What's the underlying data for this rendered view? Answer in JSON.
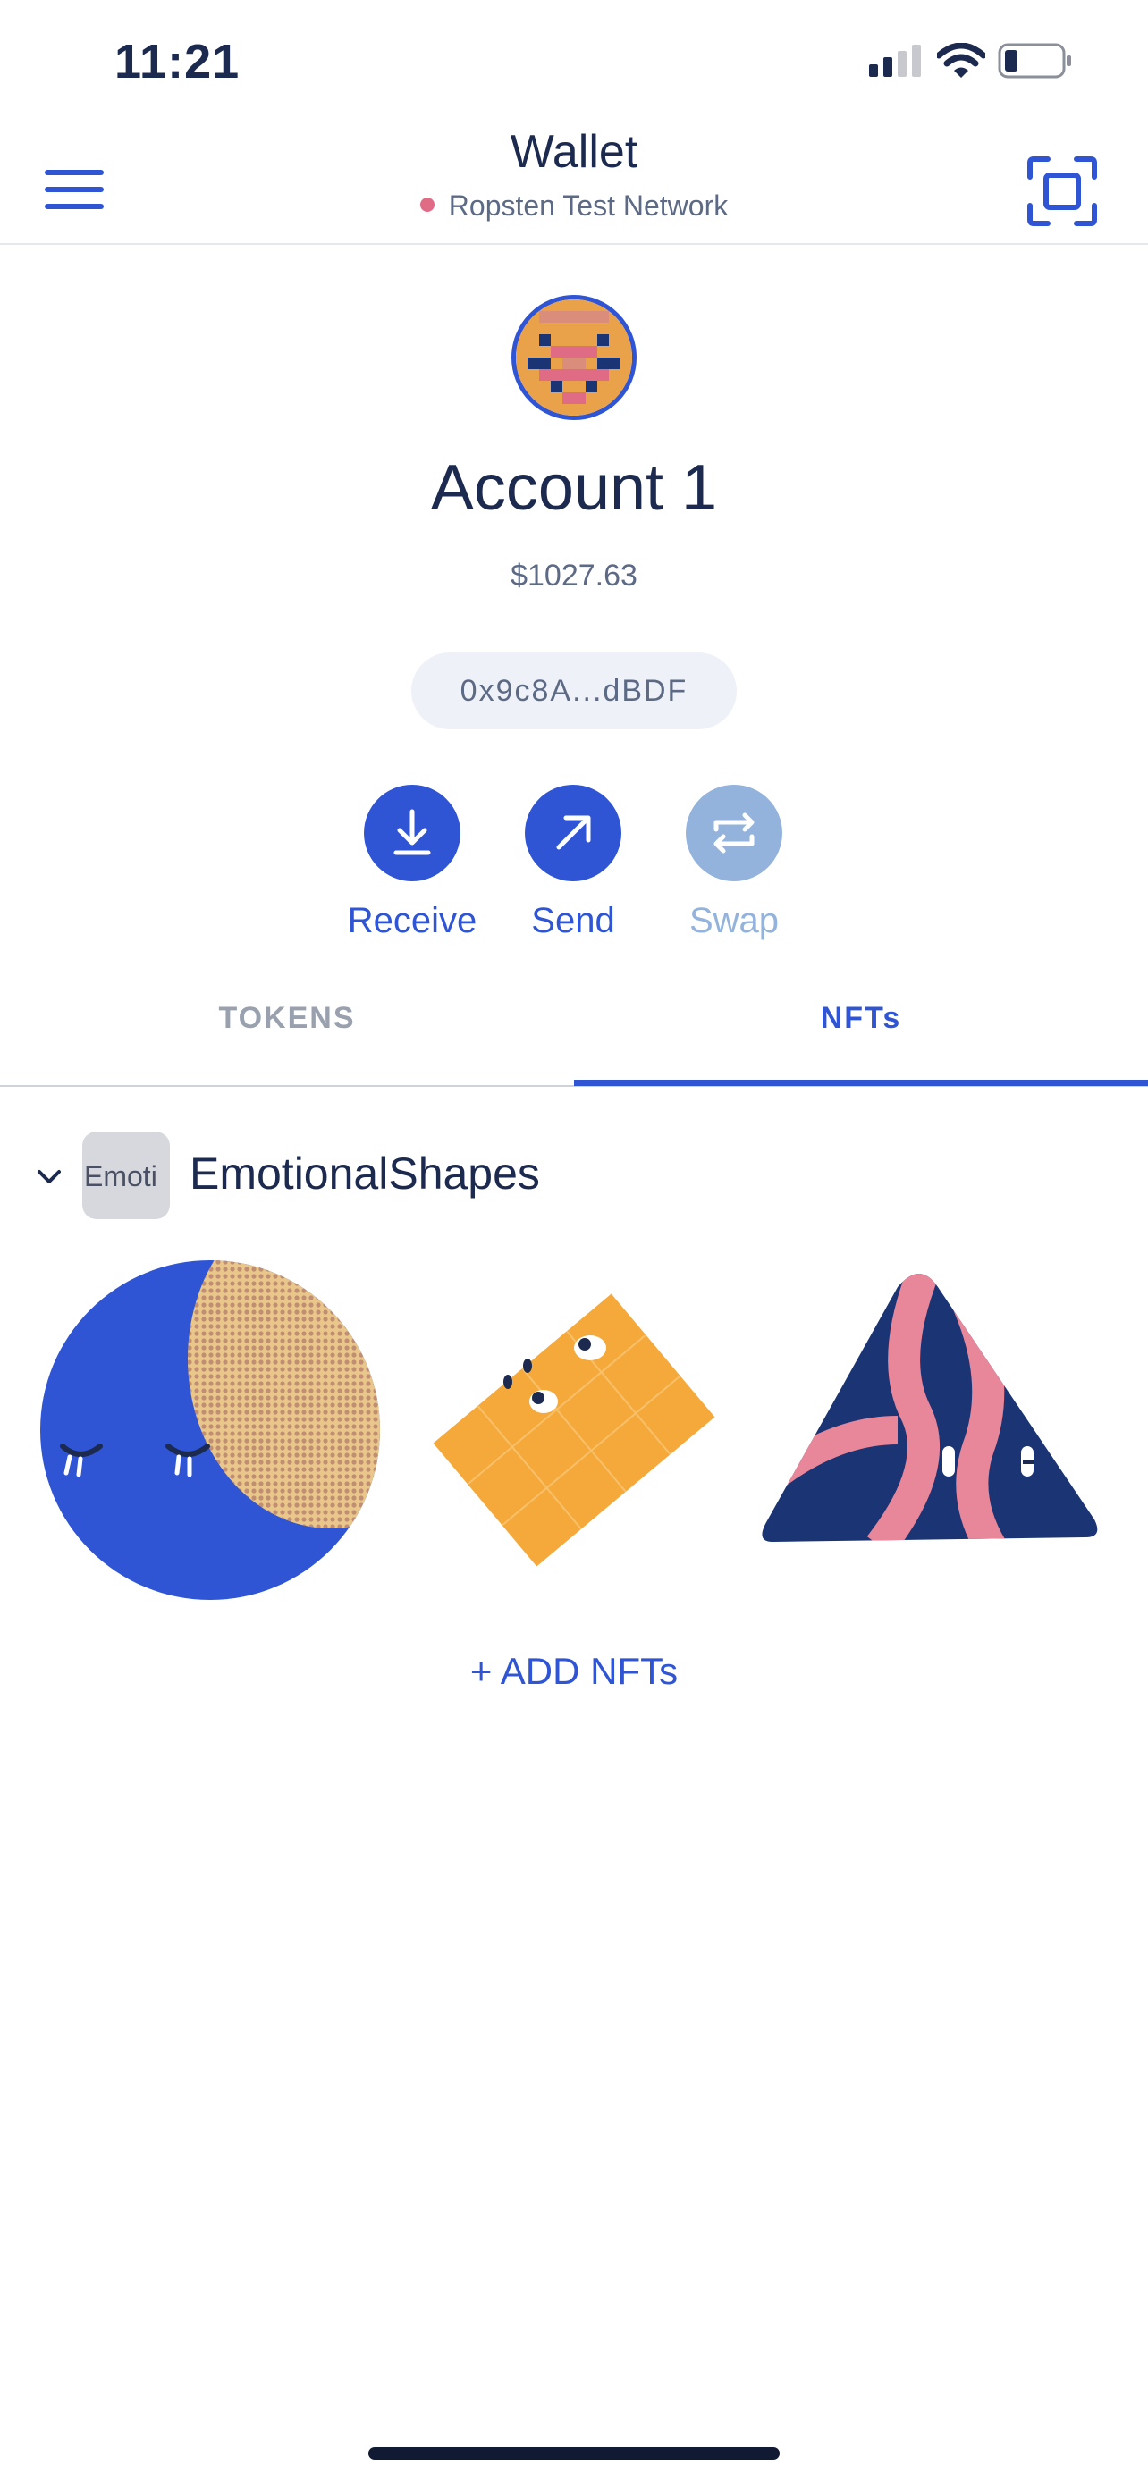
{
  "status_bar": {
    "time": "11:21",
    "signal_icon": "cellular-signal-icon",
    "wifi_icon": "wifi-icon",
    "battery_icon": "battery-low-icon"
  },
  "header": {
    "title": "Wallet",
    "network": "Ropsten Test Network",
    "network_dot_color": "#e06b85",
    "menu_icon": "hamburger-menu-icon",
    "scan_icon": "qr-scan-icon"
  },
  "account": {
    "name": "Account 1",
    "balance": "$1027.63",
    "address": "0x9c8A...dBDF"
  },
  "actions": [
    {
      "label": "Receive",
      "icon": "download-arrow-icon",
      "enabled": true
    },
    {
      "label": "Send",
      "icon": "diagonal-arrow-icon",
      "enabled": true
    },
    {
      "label": "Swap",
      "icon": "swap-arrows-icon",
      "enabled": false
    }
  ],
  "tabs": [
    {
      "label": "TOKENS",
      "active": false
    },
    {
      "label": "NFTs",
      "active": true
    }
  ],
  "collection": {
    "name": "EmotionalShapes",
    "thumb_text": "Emoti",
    "expanded": true,
    "nfts": [
      {
        "shape": "circle",
        "color": "#2f55d4"
      },
      {
        "shape": "rectangle",
        "color": "#f5a93a"
      },
      {
        "shape": "triangle",
        "color": "#1b3474"
      }
    ]
  },
  "add_nfts_label": "+ ADD NFTs",
  "colors": {
    "accent": "#2f55d4",
    "accent_disabled": "#93b3dd",
    "text_primary": "#1b2a4e",
    "text_secondary": "#5d6a86"
  }
}
